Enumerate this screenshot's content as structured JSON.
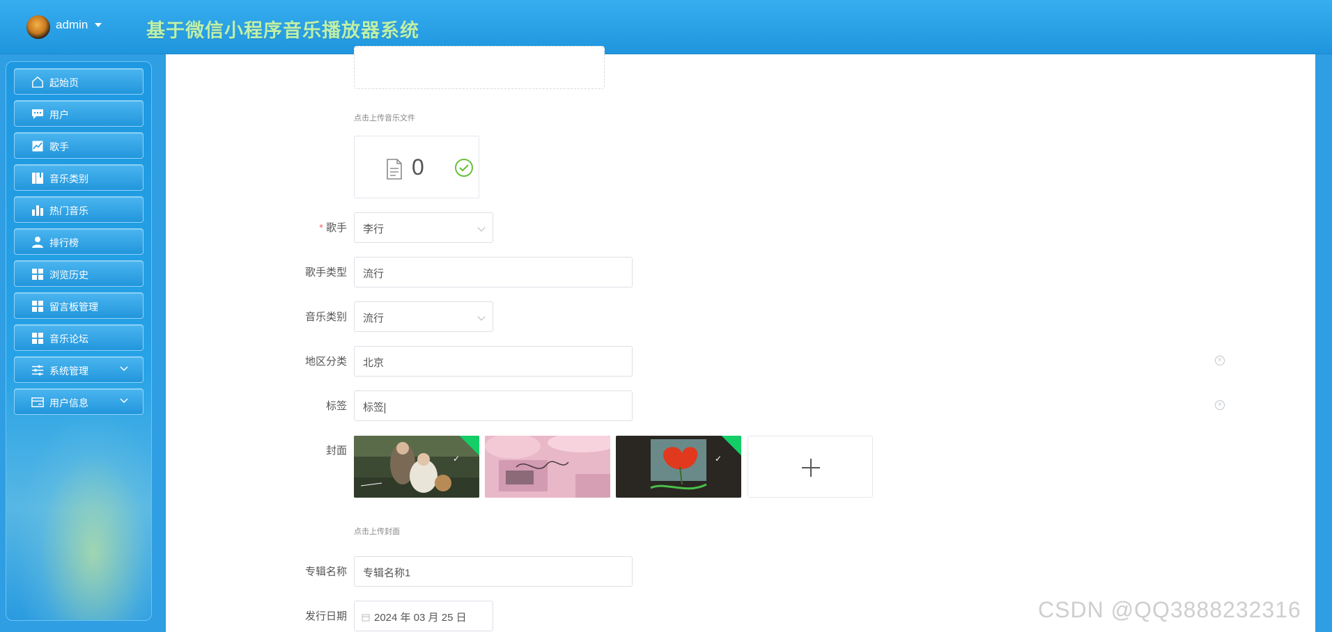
{
  "header": {
    "user": "admin",
    "title": "基于微信小程序音乐播放器系统"
  },
  "sidebar": {
    "items": [
      {
        "label": "起始页",
        "icon": "home-icon"
      },
      {
        "label": "用户",
        "icon": "chat-icon"
      },
      {
        "label": "歌手",
        "icon": "chart-line-icon"
      },
      {
        "label": "音乐类别",
        "icon": "book-icon"
      },
      {
        "label": "热门音乐",
        "icon": "bar-chart-icon"
      },
      {
        "label": "排行榜",
        "icon": "user-icon"
      },
      {
        "label": "浏览历史",
        "icon": "grid-icon"
      },
      {
        "label": "留言板管理",
        "icon": "grid-icon"
      },
      {
        "label": "音乐论坛",
        "icon": "grid-icon"
      },
      {
        "label": "系统管理",
        "icon": "sliders-icon"
      },
      {
        "label": "用户信息",
        "icon": "card-icon"
      }
    ]
  },
  "form": {
    "music_upload_hint": "点击上传音乐文件",
    "file_count": "0",
    "singer": {
      "label": "歌手",
      "value": "李行"
    },
    "singer_type": {
      "label": "歌手类型",
      "value": "流行"
    },
    "music_category": {
      "label": "音乐类别",
      "value": "流行"
    },
    "region": {
      "label": "地区分类",
      "value": "北京"
    },
    "tags": {
      "label": "标签",
      "value": "标签"
    },
    "cover": {
      "label": "封面",
      "hint": "点击上传封面"
    },
    "album": {
      "label": "专辑名称",
      "value": "专辑名称1"
    },
    "release_date": {
      "label": "发行日期",
      "value": "2024 年 03 月 25 日"
    }
  },
  "watermark": "CSDN @QQ3888232316",
  "colors": {
    "header": "#2aa5ec",
    "title": "#bff0a8",
    "required": "#f56c6c",
    "success": "#13ce66"
  }
}
